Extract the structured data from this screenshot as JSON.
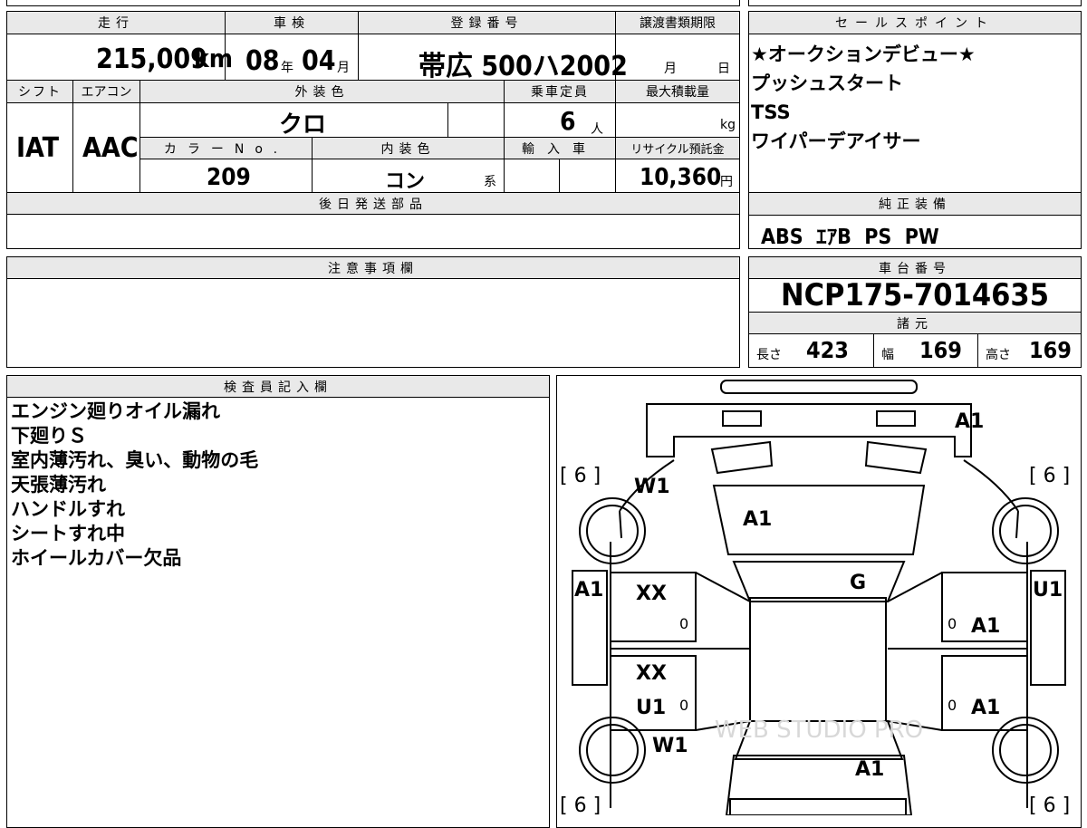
{
  "header": {
    "mileage_label": "走行",
    "inspection_label": "車検",
    "registration_label": "登録番号",
    "transfer_deadline_label": "譲渡書類期限",
    "sales_point_label": "セールスポイント"
  },
  "values": {
    "mileage": "215,009",
    "mileage_unit": "km",
    "inspection_year": "08",
    "year_unit": "年",
    "inspection_month": "04",
    "month_unit": "月",
    "registration": "帯広 500ハ2002",
    "deadline_month_unit": "月",
    "deadline_day_unit": "日"
  },
  "row2": {
    "shift_label": "シフト",
    "aircon_label": "エアコン",
    "exterior_color_label": "外装色",
    "capacity_label": "乗車定員",
    "max_load_label": "最大積載量",
    "shift": "IAT",
    "aircon": "AAC",
    "exterior_color": "クロ",
    "capacity": "6",
    "capacity_unit": "人",
    "load_unit": "kg",
    "color_no_label": "カラーNo.",
    "interior_color_label": "内装色",
    "import_label": "輸入車",
    "recycle_label": "リサイクル預託金",
    "color_no": "209",
    "interior_color": "コン",
    "interior_suffix": "系",
    "recycle_fee": "10,360",
    "yen_unit": "円"
  },
  "later_parts_label": "後日発送部品",
  "notes_label": "注意事項欄",
  "sales_points": [
    "★オークションデビュー★",
    "プッシュスタート",
    "TSS",
    "ワイパーデアイサー"
  ],
  "genuine_equipment": {
    "label": "純正装備",
    "items": "ABS  ｴｱB  PS  PW"
  },
  "chassis": {
    "label": "車台番号",
    "number": "NCP175-7014635"
  },
  "specs": {
    "label": "諸元",
    "length_label": "長さ",
    "length": "423",
    "width_label": "幅",
    "width": "169",
    "height_label": "高さ",
    "height": "169"
  },
  "inspector": {
    "label": "検査員記入欄",
    "notes": [
      "エンジン廻りオイル漏れ",
      "下廻りＳ",
      "室内薄汚れ、臭い、動物の毛",
      "天張薄汚れ",
      "ハンドルすれ",
      "シートすれ中",
      "ホイールカバー欠品"
    ]
  },
  "diagram": {
    "tread_front_left": "[ 6 ]",
    "tread_front_right": "[ 6 ]",
    "tread_rear_left": "[ 6 ]",
    "tread_rear_right": "[ 6 ]",
    "front_bumper": "A1",
    "hood": "A1",
    "front_left_wheel": "W1",
    "left_front_fender": "A1",
    "right_front_fender": "U1",
    "windshield": "G",
    "left_front_door": "XX",
    "left_rear_door_1": "XX",
    "left_rear_door_2": "U1",
    "right_front_door": "A1",
    "right_rear_door": "A1",
    "rear_left_wheel": "W1",
    "rear": "A1",
    "zero": "0",
    "watermark": "WEB STUDIO PRO"
  }
}
